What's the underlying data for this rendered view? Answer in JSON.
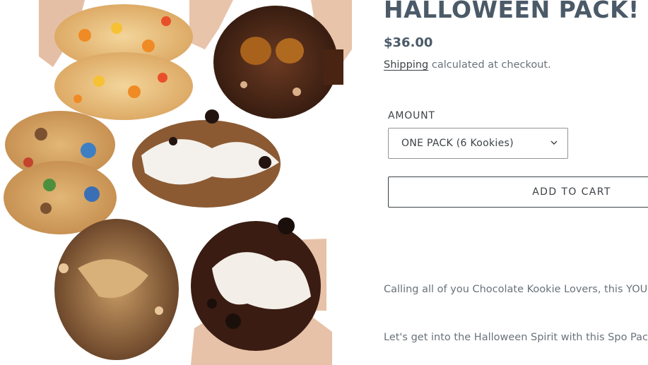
{
  "product": {
    "title": "HALLOWEEN PACK!",
    "price": "$36.00",
    "shipping_link": "Shipping",
    "shipping_note": " calculated at checkout."
  },
  "options": {
    "amount_label": "AMOUNT",
    "selected": "ONE PACK (6 Kookies)"
  },
  "cart": {
    "button_label": "ADD TO CART"
  },
  "description": {
    "paragraph_1": "Calling all of you Chocolate Kookie Lovers, this YOU!",
    "paragraph_2": "Let's get into the Halloween Spirit with this Spo Pack!"
  },
  "colors": {
    "title": "#4b5a68",
    "text": "#3d4246",
    "muted": "#69727b",
    "border": "#949494"
  },
  "gallery": {
    "image_description_icon": "cookie-photo-icon"
  }
}
